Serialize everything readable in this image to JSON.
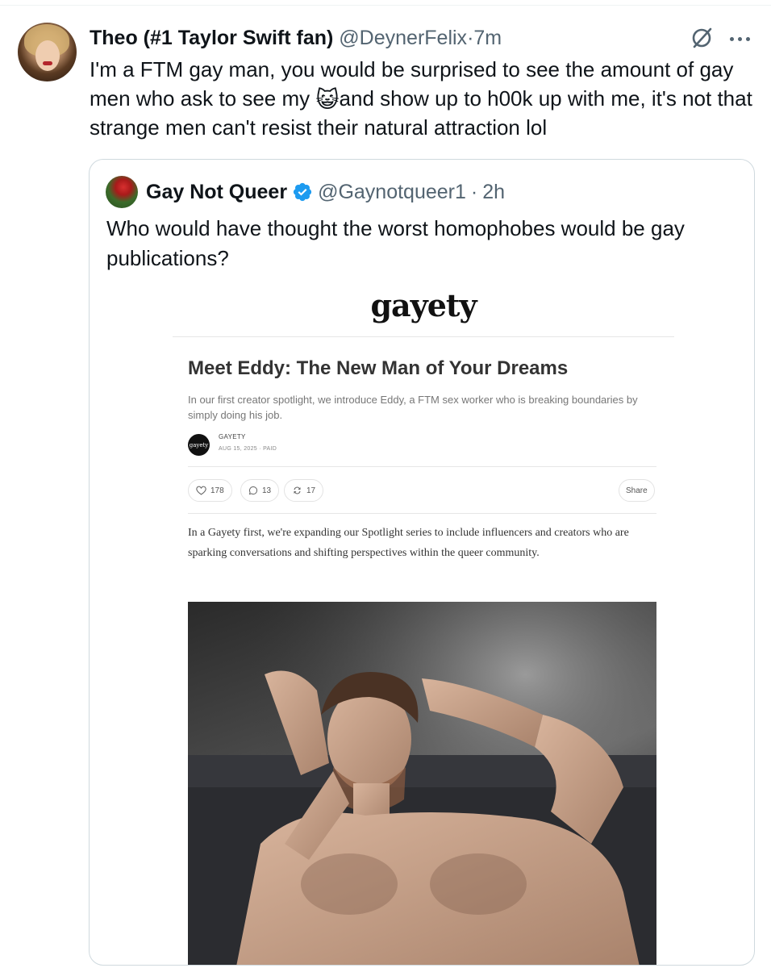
{
  "tweet": {
    "author_name": "Theo (#1 Taylor Swift fan)",
    "handle": "@DeynerFelix",
    "separator": "·",
    "time": "7m",
    "text_part1": "I'm a FTM gay man, you would be surprised to see the amount of gay men who ask to see my ",
    "emoji": "😺",
    "text_part2": "and show up to h00k up with me, it's not that strange men can't resist their natural attraction lol"
  },
  "quoted_tweet": {
    "author_name": "Gay Not Queer",
    "handle": "@Gaynotqueer1",
    "separator": "·",
    "time": "2h",
    "text": "Who would have thought the worst homophobes would be gay publications?"
  },
  "article": {
    "logo": "gayety",
    "title": "Meet Eddy: The New Man of Your Dreams",
    "subtitle": "In our first creator spotlight, we introduce Eddy, a FTM sex worker who is breaking boundaries by simply doing his job.",
    "publisher_avatar_text": "gayety",
    "publisher": "GAYETY",
    "meta": "AUG 15, 2025 · PAID",
    "likes": "178",
    "comments": "13",
    "restacks": "17",
    "share_label": "Share",
    "body": "In a Gayety first, we're expanding our Spotlight series to include influencers and creators who are sparking conversations and shifting perspectives within the queer community."
  },
  "colors": {
    "text_primary": "#0f1419",
    "text_secondary": "#536471",
    "verified_blue": "#1d9bf0",
    "border": "#cfd9de"
  },
  "icons": [
    "grok-icon",
    "more-icon",
    "verified-icon",
    "heart-icon",
    "comment-icon",
    "restack-icon"
  ]
}
